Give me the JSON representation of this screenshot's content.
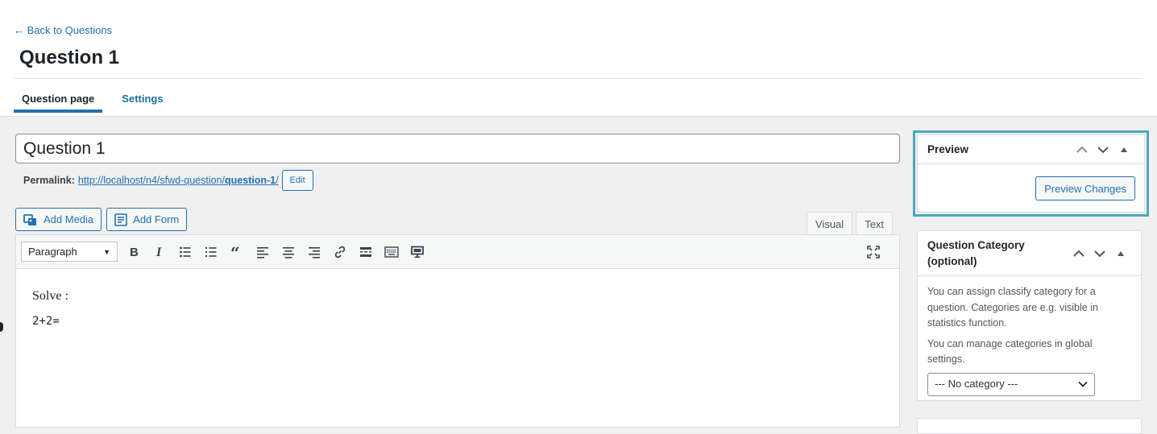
{
  "header": {
    "back_label": "← Back to Questions",
    "page_title": "Question 1",
    "tabs": [
      {
        "label": "Question page",
        "active": true
      },
      {
        "label": "Settings",
        "active": false
      }
    ]
  },
  "post": {
    "title_value": "Question 1",
    "permalink_label": "Permalink:",
    "permalink_base": "http://localhost/n4/sfwd-question/",
    "permalink_slug": "question-1",
    "permalink_trailing": "/",
    "edit_label": "Edit"
  },
  "media": {
    "add_media_label": "Add Media",
    "add_form_label": "Add Form"
  },
  "editor": {
    "tab_visual": "Visual",
    "tab_text": "Text",
    "format_value": "Paragraph",
    "content_line1": "Solve :",
    "content_line2": "2+2="
  },
  "sidebar": {
    "preview": {
      "title": "Preview",
      "button_label": "Preview Changes"
    },
    "category": {
      "title_line1": "Question Category",
      "title_line2": "(optional)",
      "desc1": "You can assign classify category for a question. Categories are e.g. visible in statistics function.",
      "desc2": "You can manage categories in global settings.",
      "select_value": "--- No category ---"
    }
  },
  "colors": {
    "accent": "#2271b1",
    "highlight": "#4ba8c0",
    "background": "#f0f0f1"
  }
}
